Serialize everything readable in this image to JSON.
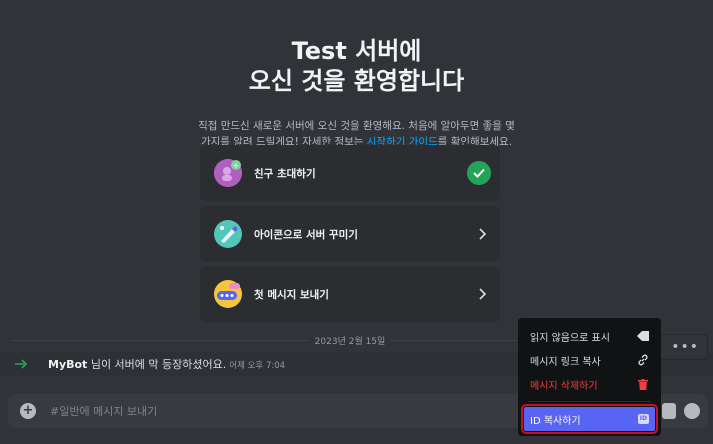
{
  "welcome": {
    "title_line1": "Test 서버에",
    "title_line2": "오신 것을 환영합니다",
    "subtitle_pre": "직접 만드신 새로운 서버에 오신 것을 환영해요. 처음에 알아두면 좋을 몇 가지를 알려    드릴게요! 자세한 정보는 ",
    "subtitle_link": "시작하기 가이드",
    "subtitle_post": "를 확인해보세요."
  },
  "cards": [
    {
      "label": "친구 초대하기",
      "status": "complete",
      "icon": "invite-friends-icon"
    },
    {
      "label": "아이콘으로 서버 꾸미기",
      "status": "pending",
      "icon": "server-icon-paint-icon"
    },
    {
      "label": "첫 메시지 보내기",
      "status": "pending",
      "icon": "first-message-icon"
    }
  ],
  "divider": {
    "date": "2023년 2월 15일"
  },
  "message": {
    "author": "MyBot",
    "text": " 님이 서버에 막 등장하셨어요.",
    "time": "어제 오후 7:04"
  },
  "composer": {
    "placeholder": "#일반에 메시지 보내기"
  },
  "context_menu": {
    "items": [
      {
        "label": "읽지 않음으로 표시",
        "icon": "mark-unread-icon",
        "type": "normal"
      },
      {
        "label": "메시지 링크 복사",
        "icon": "link-icon",
        "type": "normal"
      },
      {
        "label": "메시지 삭제하기",
        "icon": "trash-icon",
        "type": "danger"
      },
      {
        "label": "ID 복사하기",
        "icon": "id-icon",
        "type": "highlighted"
      }
    ],
    "id_badge": "ID"
  },
  "colors": {
    "background": "#313338",
    "accent": "#5865f2",
    "success": "#23a559",
    "danger": "#f23f43",
    "link": "#00a8fc",
    "highlight_box": "#c0141f"
  }
}
